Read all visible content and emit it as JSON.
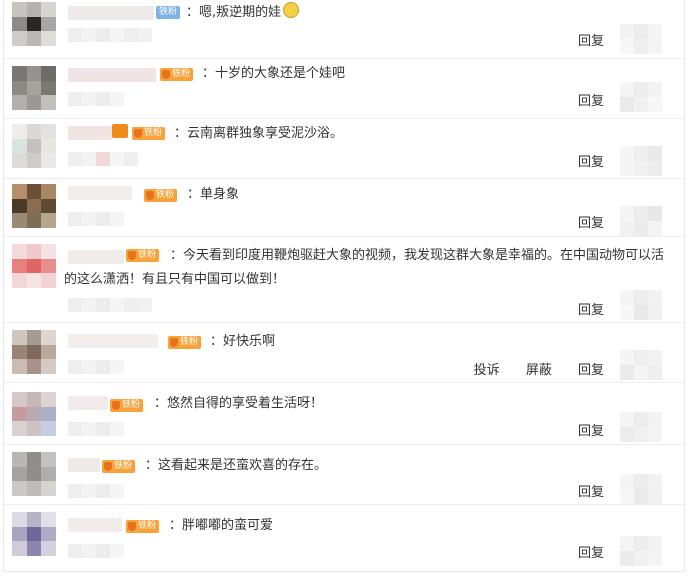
{
  "reply_label": "回复",
  "report_label": "投诉",
  "block_label": "屏蔽",
  "comments": [
    {
      "text": "：嗯,叛逆期的娃",
      "badge": "铁粉",
      "badge_color": "#7fb3e8"
    },
    {
      "text": "：十岁的大象还是个娃吧",
      "badge": "铁粉",
      "badge_color": "#f7a23a"
    },
    {
      "text": "：云南离群独象享受泥沙浴。",
      "badge": "铁粉",
      "badge_color": "#f7a23a"
    },
    {
      "text": "：单身象",
      "badge": "铁粉",
      "badge_color": "#f7a23a"
    },
    {
      "text": "：今天看到印度用鞭炮驱赶大象的视频，我发现这群大象是幸福的。在中国动物可以活的这么潇洒！有且只有中国可以做到！",
      "badge": "铁粉",
      "badge_color": "#f7a23a"
    },
    {
      "text": "：好快乐啊",
      "badge": "铁粉",
      "badge_color": "#f7a23a"
    },
    {
      "text": "：悠然自得的享受着生活呀！",
      "badge": "铁粉",
      "badge_color": "#f7a23a"
    },
    {
      "text": "：这看起来是还蛮欢喜的存在。",
      "badge": "铁粉",
      "badge_color": "#f7a23a"
    },
    {
      "text": "：胖嘟嘟的蛮可爱",
      "badge": "铁粉",
      "badge_color": "#f7a23a"
    }
  ]
}
